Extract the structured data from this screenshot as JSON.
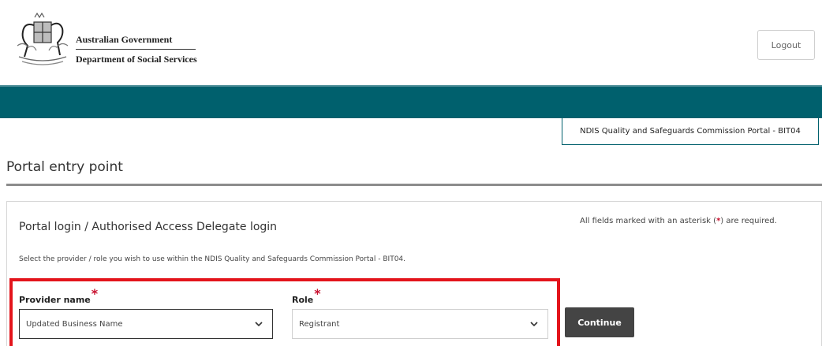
{
  "header": {
    "gov_line1": "Australian Government",
    "gov_line2": "Department of Social Services",
    "crest_icon": "australian-coat-of-arms-icon",
    "logout_label": "Logout"
  },
  "colors": {
    "nav_bar": "#00606d",
    "highlight_border": "#e3141b",
    "required_star": "#c8102e",
    "continue_button": "#444444"
  },
  "portal_badge": "NDIS Quality and Safeguards Commission Portal - BIT04",
  "page_title": "Portal entry point",
  "panel": {
    "title": "Portal login / Authorised Access Delegate login",
    "required_note_prefix": "All fields marked with an asterisk (",
    "required_note_star": "*",
    "required_note_suffix": ") are required.",
    "instruction": "Select the provider / role you wish to use within the NDIS Quality and Safeguards Commission Portal - BIT04."
  },
  "form": {
    "provider_label": "Provider name",
    "provider_value": "Updated Business Name",
    "role_label": "Role",
    "role_value": "Registrant",
    "required_marker": "*",
    "continue_label": "Continue"
  }
}
